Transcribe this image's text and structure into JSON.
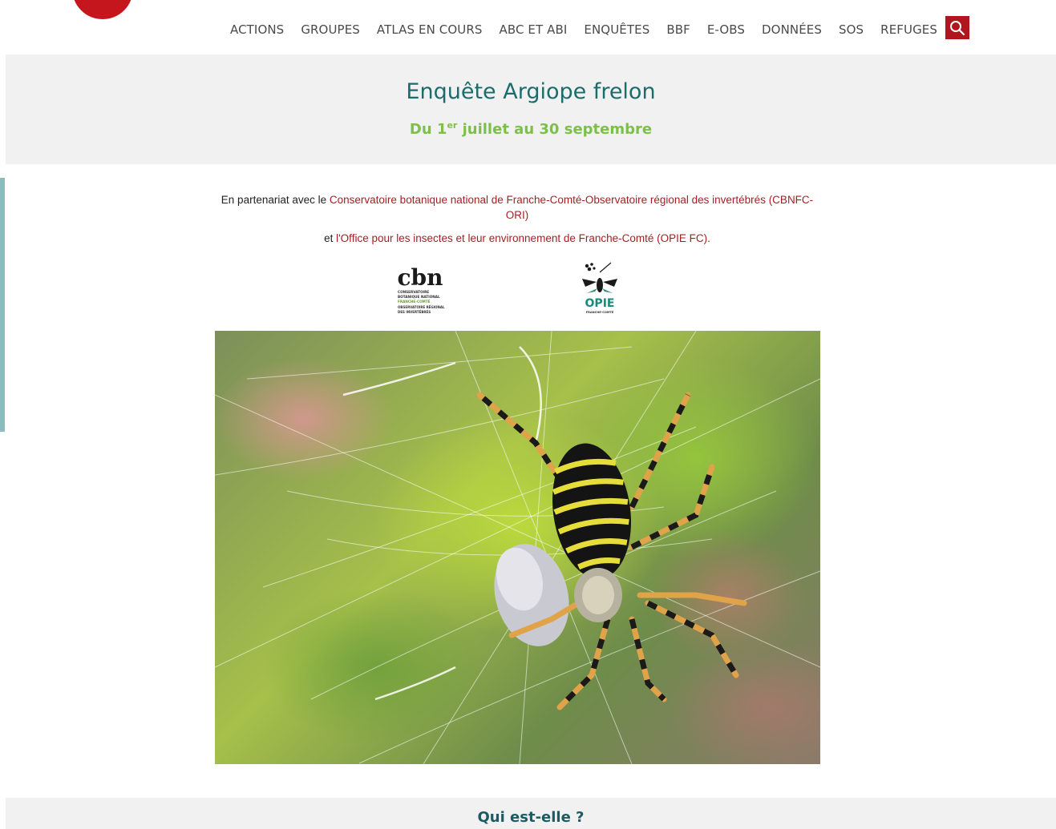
{
  "nav": {
    "items": [
      {
        "label": "ACTIONS"
      },
      {
        "label": "GROUPES"
      },
      {
        "label": "ATLAS EN COURS"
      },
      {
        "label": "ABC ET ABI"
      },
      {
        "label": "ENQUÊTES"
      },
      {
        "label": "BBF"
      },
      {
        "label": "E-OBS"
      },
      {
        "label": "DONNÉES"
      },
      {
        "label": "SOS"
      },
      {
        "label": "REFUGES"
      }
    ],
    "search_icon": "search-icon"
  },
  "hero": {
    "title": "Enquête Argiope frelon",
    "dates_prefix": "Du 1",
    "dates_sup": "er",
    "dates_suffix": " juillet au 30 septembre"
  },
  "partner": {
    "line1_prefix": "En partenariat avec le ",
    "line1_link": "Conservatoire botanique national de Franche-Comté-Observatoire régional des invertébrés (CBNFC-ORI)",
    "line2_prefix": "et ",
    "line2_link": "l'Office pour les insectes et leur environnement de Franche-Comté (OPIE FC)."
  },
  "logos": {
    "cbn": {
      "mark": "cbn",
      "sub1": "CONSERVATOIRE",
      "sub2": "BOTANIQUE NATIONAL",
      "sub3": "FRANCHE-COMTÉ",
      "sub4": "OBSERVATOIRE RÉGIONAL",
      "sub5": "DES INVERTÉBRÉS"
    },
    "opie": {
      "mark": "OPIE",
      "sub": "FRANCHE-COMTÉ"
    }
  },
  "section": {
    "title": "Qui est-elle ?"
  },
  "colors": {
    "brand_red": "#b0161d",
    "title_teal": "#1d6b6b",
    "date_green": "#7cc04a",
    "link_red": "#a41f24"
  }
}
